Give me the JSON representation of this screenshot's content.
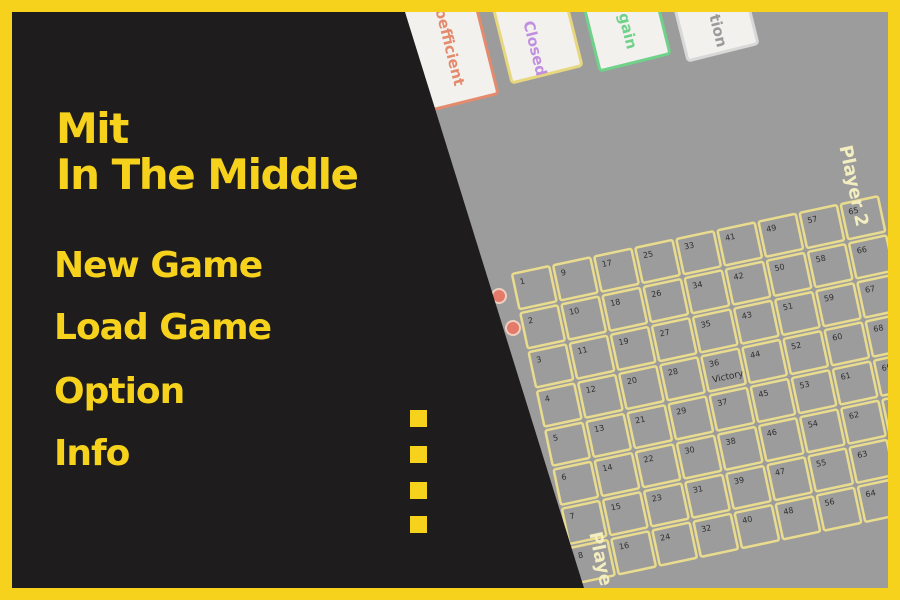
{
  "colors": {
    "accent": "#f6d21c",
    "panel": "#1e1c1d",
    "board_bg": "#9c9c9c",
    "grid_line": "#e9dc8e"
  },
  "title": {
    "line1": "Mit",
    "line2": "In The Middle"
  },
  "menu": {
    "items": [
      {
        "label": "New Game"
      },
      {
        "label": "Load Game"
      },
      {
        "label": "Option"
      },
      {
        "label": "Info"
      }
    ]
  },
  "background": {
    "cards": [
      {
        "label": "Coefficient",
        "color": "#e48b6e"
      },
      {
        "label": "Closed",
        "color": "#c18fe0"
      },
      {
        "label": "gain",
        "color": "#6fd18a"
      },
      {
        "label": "tion",
        "color": "#e0e0e0"
      }
    ],
    "board_labels": {
      "player_top": "Player 2",
      "player_bottom": "Playe",
      "center": "Victory"
    }
  }
}
